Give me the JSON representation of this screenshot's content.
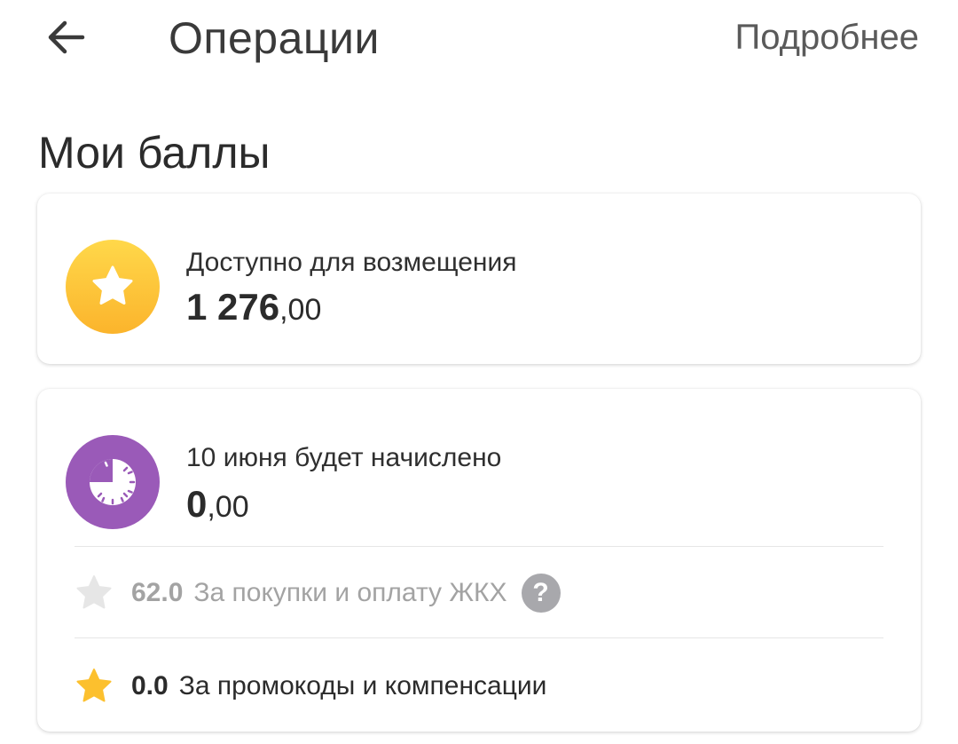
{
  "header": {
    "title": "Операции",
    "details_link": "Подробнее"
  },
  "section": {
    "title": "Мои баллы"
  },
  "available": {
    "label": "Доступно для возмещения",
    "amount_int": "1 276",
    "amount_dec": ",00",
    "icon": "star-coin-icon"
  },
  "accrual": {
    "label": "10 июня будет начислено",
    "amount_int": "0",
    "amount_dec": ",00",
    "icon": "clock-icon",
    "items": [
      {
        "value": "62.0",
        "text": "За покупки и оплату ЖКХ",
        "icon": "gray-star-icon",
        "help": "?"
      },
      {
        "value": "0.0",
        "text": "За промокоды и компенсации",
        "icon": "yellow-star-icon"
      }
    ]
  },
  "colors": {
    "coin_top": "#ffd84a",
    "coin_bottom": "#fbb42c",
    "clock": "#9a5ab8",
    "muted_text": "#a3a3a3",
    "help_badge": "#a8a8ac",
    "yellow_star": "#fcc02e",
    "gray_star": "#e6e6e6"
  }
}
